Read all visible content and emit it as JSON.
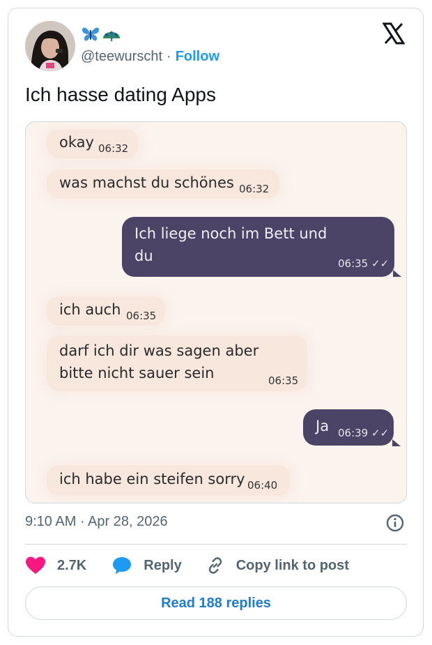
{
  "author": {
    "emojis": [
      "butterfly-emoji",
      "peacock-emoji"
    ],
    "handle": "@teewurscht",
    "separator": "·",
    "follow_label": "Follow"
  },
  "tweet": {
    "text": "Ich hasse dating Apps"
  },
  "chat": {
    "messages": [
      {
        "direction": "in",
        "text": "okay",
        "time": "06:32"
      },
      {
        "direction": "in",
        "text": "was machst du schönes",
        "time": "06:32"
      },
      {
        "direction": "out",
        "text_lines": [
          "Ich liege noch im Bett und",
          "du"
        ],
        "time": "06:35 ✓✓"
      },
      {
        "direction": "in",
        "text": "ich auch",
        "time": "06:35"
      },
      {
        "direction": "in",
        "text_lines": [
          "darf ich dir was sagen aber",
          "bitte nicht sauer sein"
        ],
        "time": "06:35"
      },
      {
        "direction": "out",
        "text": "Ja",
        "time": "06:39 ✓✓"
      },
      {
        "direction": "in",
        "text": "ich habe ein steifen sorry",
        "time": "06:40"
      }
    ]
  },
  "meta": {
    "timestamp": "9:10 AM · Apr 28, 2026"
  },
  "actions": {
    "like_count": "2.7K",
    "reply_label": "Reply",
    "copy_label": "Copy link to post"
  },
  "read_replies_label": "Read 188 replies",
  "colors": {
    "accent": "#1d9bf0",
    "like": "#f91880",
    "reply_icon": "#1d9bf0",
    "outgoing_bubble": "#4b4466",
    "incoming_bubble": "#f7e7dd"
  }
}
